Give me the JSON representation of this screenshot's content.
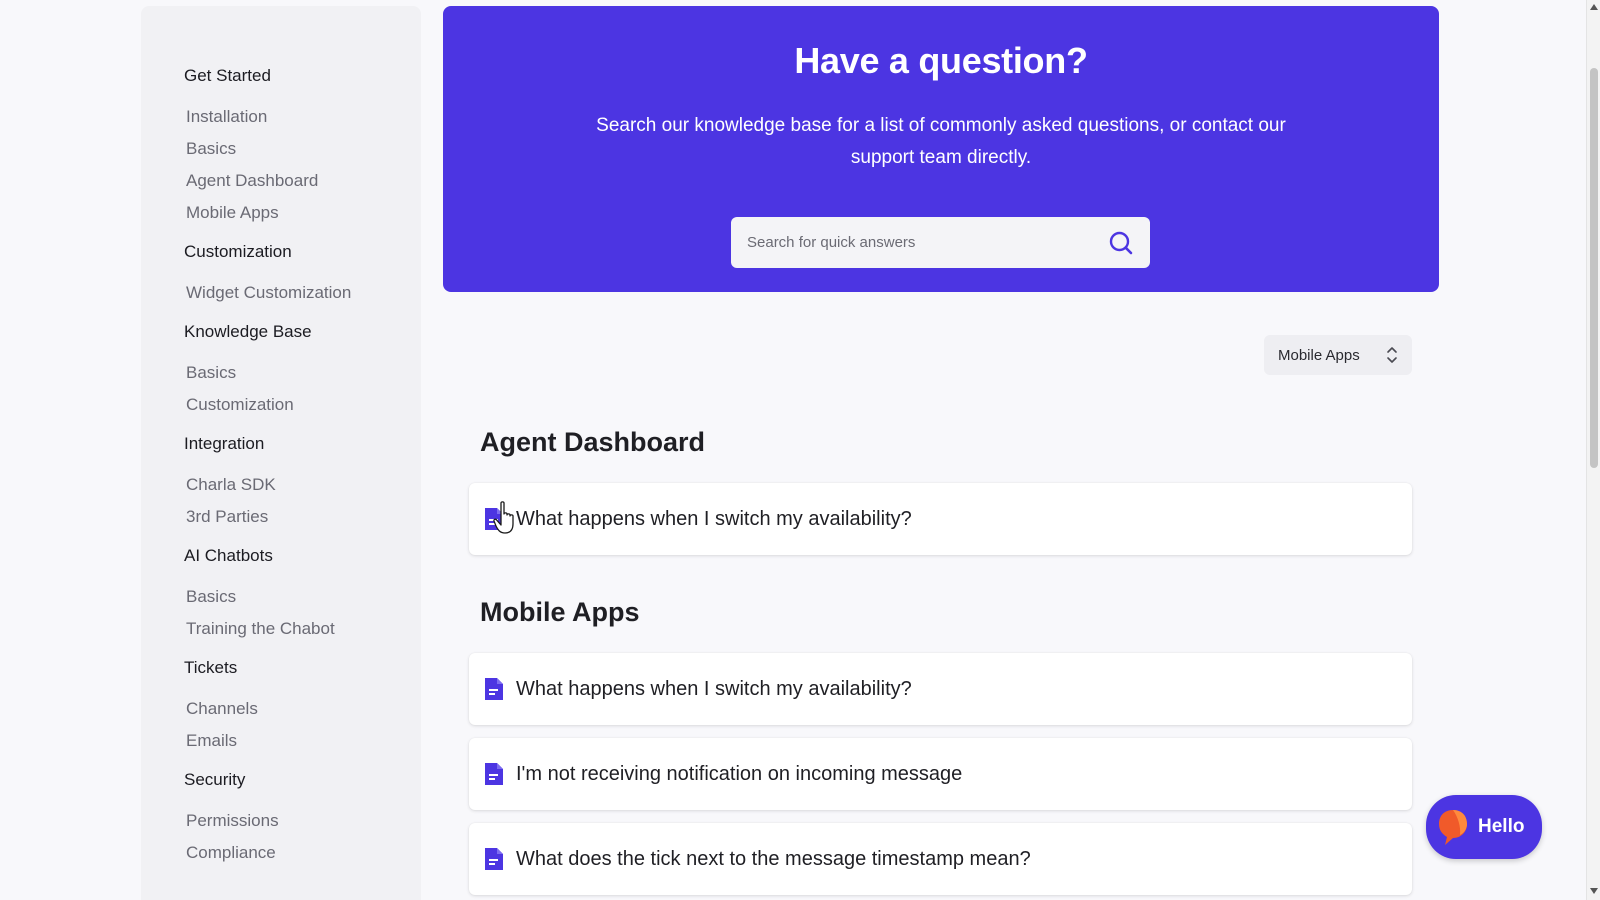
{
  "sidebar": {
    "sections": [
      {
        "heading": "Get Started",
        "items": [
          "Installation",
          "Basics",
          "Agent Dashboard",
          "Mobile Apps"
        ]
      },
      {
        "heading": "Customization",
        "items": [
          "Widget Customization"
        ]
      },
      {
        "heading": "Knowledge Base",
        "items": [
          "Basics",
          "Customization"
        ]
      },
      {
        "heading": "Integration",
        "items": [
          "Charla SDK",
          "3rd Parties"
        ]
      },
      {
        "heading": "AI Chatbots",
        "items": [
          "Basics",
          "Training the Chabot"
        ]
      },
      {
        "heading": "Tickets",
        "items": [
          "Channels",
          "Emails"
        ]
      },
      {
        "heading": "Security",
        "items": [
          "Permissions",
          "Compliance"
        ]
      }
    ]
  },
  "hero": {
    "title": "Have a question?",
    "subtitle": "Search our knowledge base for a list of commonly asked questions, or contact our support team directly.",
    "search_placeholder": "Search for quick answers",
    "background_color": "#4c35e2"
  },
  "category_select": {
    "selected": "Mobile Apps",
    "icon": "chevron-up-down-icon"
  },
  "sections": [
    {
      "title": "Agent Dashboard",
      "articles": [
        "What happens when I switch my availability?"
      ]
    },
    {
      "title": "Mobile Apps",
      "articles": [
        "What happens when I switch my availability?",
        "I'm not receiving notification on incoming message",
        "What does the tick next to the message timestamp mean?"
      ]
    }
  ],
  "chat_launcher": {
    "label": "Hello",
    "icon": "chat-logo-icon"
  },
  "colors": {
    "accent": "#4c35e2",
    "doc_icon": "#4c35e2"
  }
}
